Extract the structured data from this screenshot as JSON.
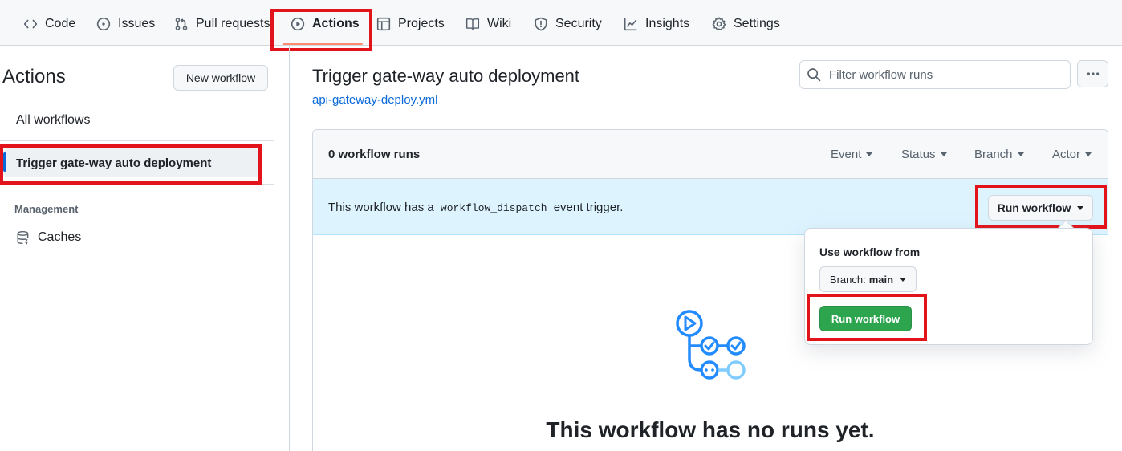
{
  "repo_nav": {
    "tabs": [
      {
        "label": "Code",
        "icon": "code-icon"
      },
      {
        "label": "Issues",
        "icon": "issue-opened-icon"
      },
      {
        "label": "Pull requests",
        "icon": "git-pull-request-icon"
      },
      {
        "label": "Actions",
        "icon": "play-icon",
        "active": true
      },
      {
        "label": "Projects",
        "icon": "table-icon"
      },
      {
        "label": "Wiki",
        "icon": "book-icon"
      },
      {
        "label": "Security",
        "icon": "shield-icon"
      },
      {
        "label": "Insights",
        "icon": "graph-icon"
      },
      {
        "label": "Settings",
        "icon": "gear-icon"
      }
    ]
  },
  "sidebar": {
    "title": "Actions",
    "new_workflow_label": "New workflow",
    "all_workflows_label": "All workflows",
    "selected_workflow_label": "Trigger gate-way auto deployment",
    "management_heading": "Management",
    "caches_label": "Caches"
  },
  "main": {
    "workflow_title": "Trigger gate-way auto deployment",
    "workflow_file": "api-gateway-deploy.yml",
    "filter_placeholder": "Filter workflow runs",
    "runs_count": "0 workflow runs",
    "filters": {
      "event": "Event",
      "status": "Status",
      "branch": "Branch",
      "actor": "Actor"
    },
    "banner": {
      "prefix": "This workflow has a",
      "code": "workflow_dispatch",
      "suffix": "event trigger."
    },
    "run_workflow_label": "Run workflow",
    "empty_title": "This workflow has no runs yet."
  },
  "popover": {
    "label": "Use workflow from",
    "branch_prefix": "Branch:",
    "branch_value": "main",
    "run_button_label": "Run workflow"
  },
  "colors": {
    "accent_blue": "#0969da",
    "tab_underline": "#fd8c73",
    "highlight_red": "#e3131b",
    "green_button": "#2da44e",
    "banner_bg": "#ddf4ff"
  }
}
